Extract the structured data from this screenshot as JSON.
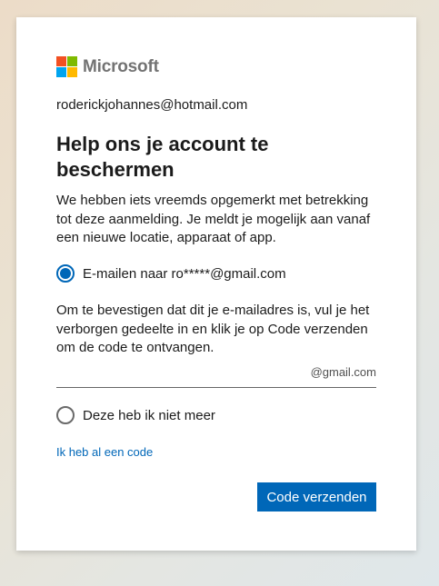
{
  "brand": {
    "name": "Microsoft",
    "colors": {
      "red": "#f25022",
      "green": "#7fba00",
      "blue": "#00a4ef",
      "yellow": "#ffb900"
    }
  },
  "identity": "roderickjohannes@hotmail.com",
  "title": "Help ons je account te beschermen",
  "description": "We hebben iets vreemds opgemerkt met betrekking tot deze aanmelding. Je meldt je mogelijk aan vanaf een nieuwe locatie, apparaat of app.",
  "options": [
    {
      "label": "E-mailen naar ro*****@gmail.com",
      "checked": true
    },
    {
      "label": "Deze heb ik niet meer",
      "checked": false
    }
  ],
  "verify_text": "Om te bevestigen dat dit je e-mailadres is, vul je het verborgen gedeelte in en klik je op Code verzenden om de code te ontvangen.",
  "email_input": {
    "value": "",
    "suffix": "@gmail.com"
  },
  "have_code_link": "Ik heb al een code",
  "submit_label": "Code verzenden",
  "accent_color": "#0067b8"
}
